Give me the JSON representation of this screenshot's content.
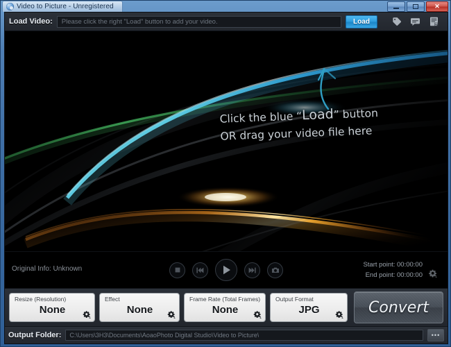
{
  "window": {
    "title": "Video to Picture - Unregistered",
    "app_icon": "app-disc-icon",
    "minimize_label": "Minimize",
    "maximize_label": "Maximize",
    "close_label": "✕",
    "border_color": "#3f6fa6"
  },
  "load_bar": {
    "label": "Load Video:",
    "input_placeholder": "Please click the right \"Load\" button to add your video.",
    "input_value": "",
    "button_label": "Load",
    "button_color": "#2f9ede",
    "icons": [
      {
        "name": "tag-icon",
        "title": "Tag"
      },
      {
        "name": "comment-icon",
        "title": "Feedback"
      },
      {
        "name": "register-document-icon",
        "title": "Register"
      }
    ]
  },
  "stage": {
    "hint_line1_prefix": "Click the blue “",
    "hint_line1_emph": "Load",
    "hint_line1_suffix": "” button",
    "hint_line2": "OR drag your video file here",
    "arrow": "curved-up-arrow",
    "arrow_color": "#2f97c4",
    "background": "#000000"
  },
  "transport": {
    "original_info": "Original Info: Unknown",
    "controls": [
      {
        "name": "stop-button",
        "label": "Stop"
      },
      {
        "name": "previous-button",
        "label": "Previous"
      },
      {
        "name": "play-button",
        "label": "Play"
      },
      {
        "name": "next-button",
        "label": "Next"
      },
      {
        "name": "snapshot-button",
        "label": "Snapshot"
      }
    ],
    "start_point": "Start point: 00:00:00",
    "end_point": "End point: 00:00:00",
    "settings_icon": "gear-icon"
  },
  "options": [
    {
      "caption": "Resize (Resolution)",
      "value": "None"
    },
    {
      "caption": "Effect",
      "value": "None"
    },
    {
      "caption": "Frame Rate (Total Frames)",
      "value": "None"
    },
    {
      "caption": "Output Format",
      "value": "JPG"
    }
  ],
  "convert": {
    "label": "Convert"
  },
  "output_folder": {
    "label": "Output Folder:",
    "path": "C:\\Users\\3H3\\Documents\\AoaoPhoto Digital Studio\\Video to Picture\\",
    "browse_label": "•••"
  }
}
